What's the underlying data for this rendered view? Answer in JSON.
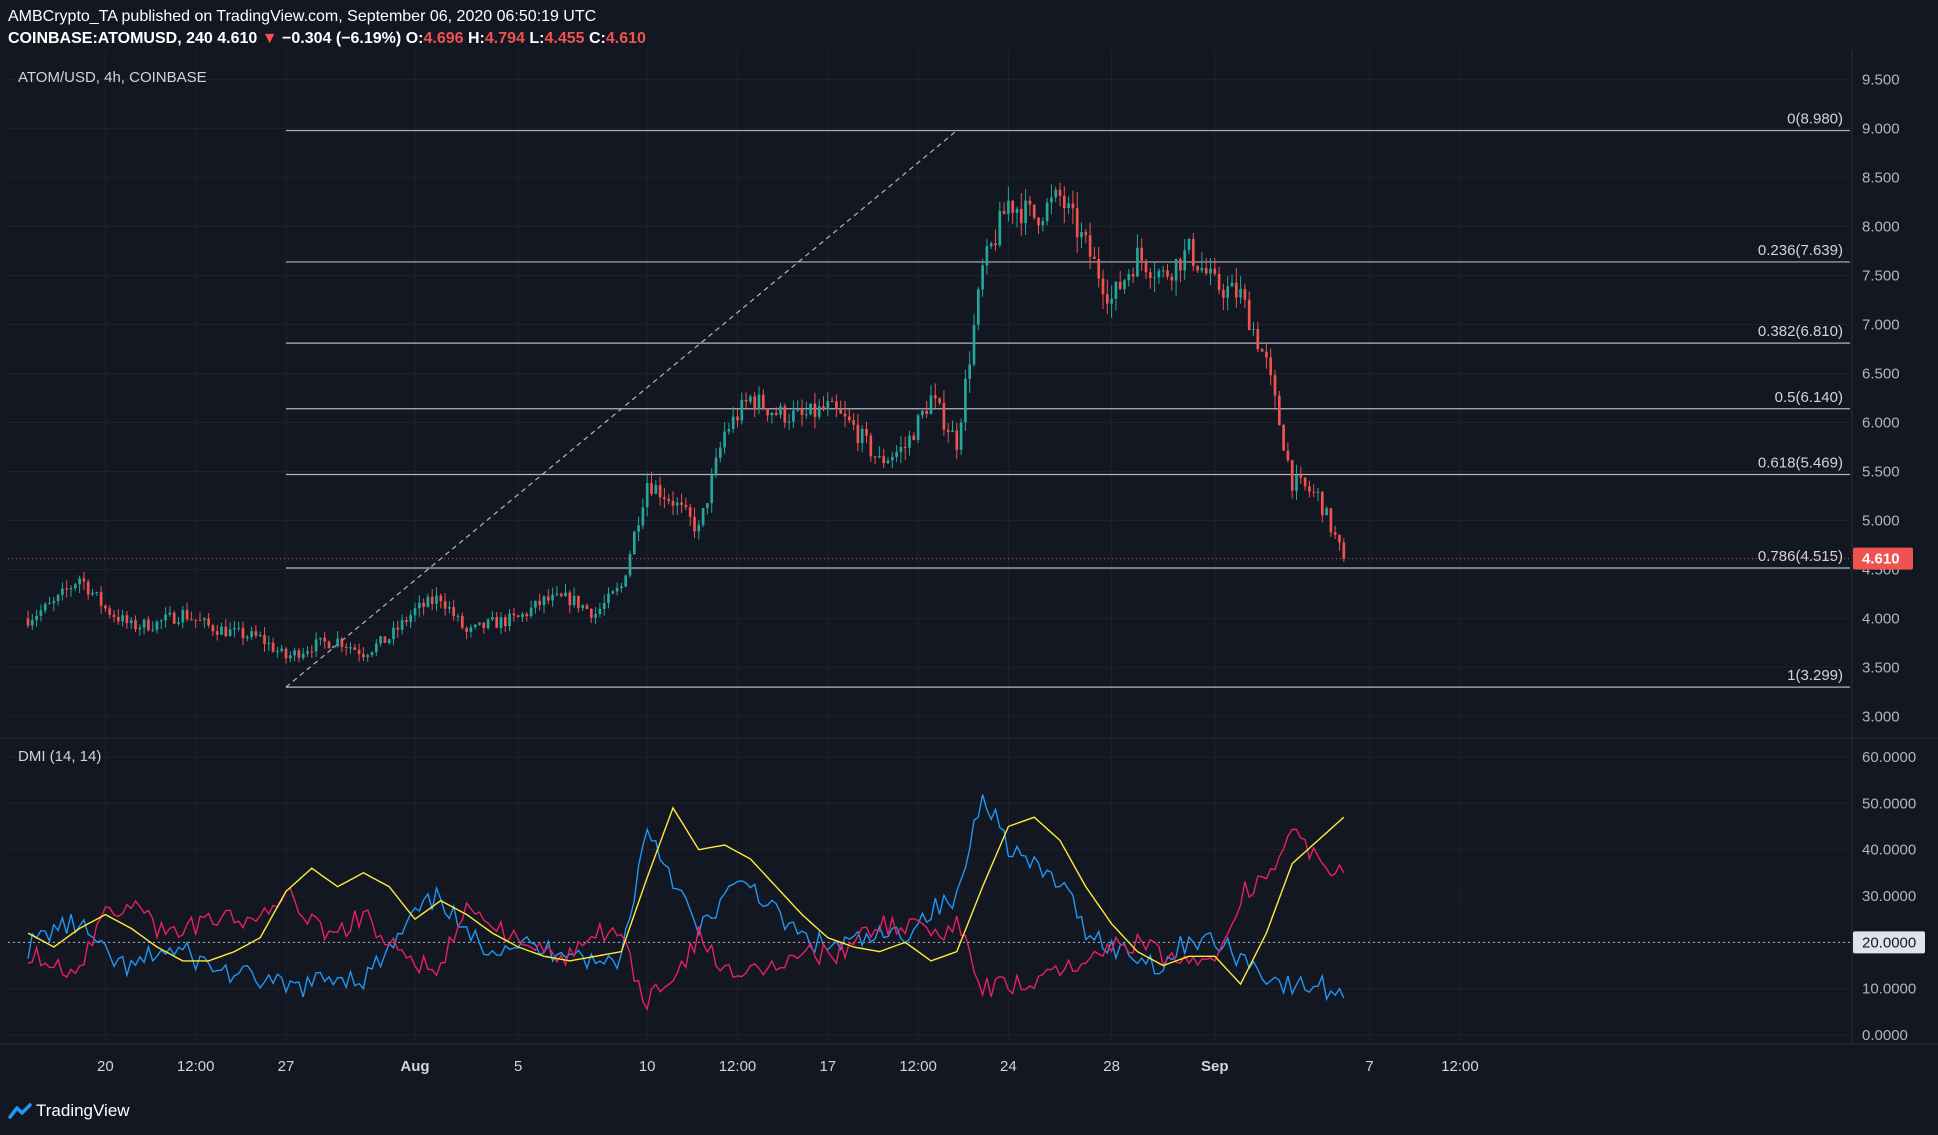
{
  "header": {
    "publisher_line": "AMBCrypto_TA published on TradingView.com, September 06, 2020 06:50:19 UTC",
    "symbol": "COINBASE:ATOMUSD, 240",
    "last": "4.610",
    "change": "−0.304 (−6.19%)",
    "o_label": "O:",
    "o": "4.696",
    "h_label": "H:",
    "h": "4.794",
    "l_label": "L:",
    "l": "4.455",
    "c_label": "C:",
    "c": "4.610"
  },
  "footer": {
    "brand": "TradingView"
  },
  "colors": {
    "bg": "#131722",
    "up": "#26a69a",
    "down": "#ef5350",
    "di_plus": "#2196f3",
    "di_minus": "#e91e63",
    "adx": "#ffeb3b"
  },
  "chart_data": [
    {
      "type": "candlestick",
      "title": "ATOM/USD, 4h, COINBASE",
      "y_ticks": [
        "9.500",
        "9.000",
        "8.500",
        "8.000",
        "7.500",
        "7.000",
        "6.500",
        "6.000",
        "5.500",
        "5.000",
        "4.500",
        "4.000",
        "3.500",
        "3.000"
      ],
      "ylim": [
        2.8,
        9.7
      ],
      "x_ticks": [
        "20",
        "12:00",
        "27",
        "Aug",
        "5",
        "10",
        "12:00",
        "17",
        "12:00",
        "24",
        "28",
        "Sep",
        "7",
        "12:00"
      ],
      "last_price": "4.610",
      "grid": true,
      "fib_levels": [
        {
          "label": "0(8.980)",
          "value": 8.98
        },
        {
          "label": "0.236(7.639)",
          "value": 7.639
        },
        {
          "label": "0.382(6.810)",
          "value": 6.81
        },
        {
          "label": "0.5(6.140)",
          "value": 6.14
        },
        {
          "label": "0.618(5.469)",
          "value": 5.469
        },
        {
          "label": "0.786(4.515)",
          "value": 4.515
        },
        {
          "label": "1(3.299)",
          "value": 3.299
        }
      ],
      "fib_trendline": {
        "from": {
          "date": "2020-07-27",
          "price": 3.299
        },
        "to": {
          "date": "2020-08-22",
          "price": 8.98
        }
      },
      "close_anchors": [
        [
          "2020-07-17",
          4.0
        ],
        [
          "2020-07-18",
          4.15
        ],
        [
          "2020-07-19",
          4.42
        ],
        [
          "2020-07-20",
          4.1
        ],
        [
          "2020-07-21",
          3.92
        ],
        [
          "2020-07-22",
          3.95
        ],
        [
          "2020-07-23",
          4.05
        ],
        [
          "2020-07-24",
          3.92
        ],
        [
          "2020-07-25",
          3.85
        ],
        [
          "2020-07-26",
          3.8
        ],
        [
          "2020-07-27",
          3.6
        ],
        [
          "2020-07-28",
          3.72
        ],
        [
          "2020-07-29",
          3.78
        ],
        [
          "2020-07-30",
          3.65
        ],
        [
          "2020-07-31",
          3.8
        ],
        [
          "2020-08-01",
          4.08
        ],
        [
          "2020-08-02",
          4.22
        ],
        [
          "2020-08-03",
          3.85
        ],
        [
          "2020-08-04",
          3.95
        ],
        [
          "2020-08-05",
          4.0
        ],
        [
          "2020-08-06",
          4.18
        ],
        [
          "2020-08-07",
          4.2
        ],
        [
          "2020-08-08",
          4.05
        ],
        [
          "2020-08-09",
          4.32
        ],
        [
          "2020-08-10",
          5.4
        ],
        [
          "2020-08-11",
          5.2
        ],
        [
          "2020-08-12",
          4.9
        ],
        [
          "2020-08-13",
          5.9
        ],
        [
          "2020-08-14",
          6.25
        ],
        [
          "2020-08-15",
          6.1
        ],
        [
          "2020-08-16",
          6.05
        ],
        [
          "2020-08-17",
          6.15
        ],
        [
          "2020-08-18",
          5.95
        ],
        [
          "2020-08-19",
          5.6
        ],
        [
          "2020-08-20",
          5.75
        ],
        [
          "2020-08-21",
          6.25
        ],
        [
          "2020-08-22",
          5.8
        ],
        [
          "2020-08-23",
          7.55
        ],
        [
          "2020-08-24",
          8.25
        ],
        [
          "2020-08-25",
          8.1
        ],
        [
          "2020-08-26",
          8.3
        ],
        [
          "2020-08-27",
          7.8
        ],
        [
          "2020-08-28",
          7.25
        ],
        [
          "2020-08-29",
          7.7
        ],
        [
          "2020-08-30",
          7.5
        ],
        [
          "2020-08-31",
          7.75
        ],
        [
          "2020-09-01",
          7.4
        ],
        [
          "2020-09-02",
          7.3
        ],
        [
          "2020-09-03",
          6.6
        ],
        [
          "2020-09-04",
          5.4
        ],
        [
          "2020-09-05",
          5.25
        ],
        [
          "2020-09-06",
          4.61
        ]
      ]
    },
    {
      "type": "line",
      "title": "DMI (14, 14)",
      "y_ticks": [
        "60.0000",
        "50.0000",
        "40.0000",
        "30.0000",
        "20.0000",
        "10.0000",
        "0.0000"
      ],
      "ylim": [
        -1.5,
        61.5
      ],
      "threshold": 20,
      "threshold_label": "20.0000",
      "series": [
        {
          "key": "di_plus",
          "color": "#2196f3",
          "values": [
            [
              "2020-07-17",
              19
            ],
            [
              "2020-07-18",
              23
            ],
            [
              "2020-07-19",
              24
            ],
            [
              "2020-07-20",
              17
            ],
            [
              "2020-07-21",
              14
            ],
            [
              "2020-07-22",
              18
            ],
            [
              "2020-07-23",
              18
            ],
            [
              "2020-07-24",
              15
            ],
            [
              "2020-07-25",
              13
            ],
            [
              "2020-07-26",
              12
            ],
            [
              "2020-07-27",
              10
            ],
            [
              "2020-07-28",
              11
            ],
            [
              "2020-07-29",
              13
            ],
            [
              "2020-07-30",
              12
            ],
            [
              "2020-07-31",
              18
            ],
            [
              "2020-08-01",
              26
            ],
            [
              "2020-08-02",
              30
            ],
            [
              "2020-08-03",
              21
            ],
            [
              "2020-08-04",
              19
            ],
            [
              "2020-08-05",
              20
            ],
            [
              "2020-08-06",
              18
            ],
            [
              "2020-08-07",
              19
            ],
            [
              "2020-08-08",
              15
            ],
            [
              "2020-08-09",
              17
            ],
            [
              "2020-08-10",
              45
            ],
            [
              "2020-08-11",
              34
            ],
            [
              "2020-08-12",
              22
            ],
            [
              "2020-08-13",
              30
            ],
            [
              "2020-08-14",
              33
            ],
            [
              "2020-08-15",
              26
            ],
            [
              "2020-08-16",
              21
            ],
            [
              "2020-08-17",
              19
            ],
            [
              "2020-08-18",
              20
            ],
            [
              "2020-08-19",
              21
            ],
            [
              "2020-08-20",
              22
            ],
            [
              "2020-08-21",
              27
            ],
            [
              "2020-08-22",
              29
            ],
            [
              "2020-08-23",
              53
            ],
            [
              "2020-08-24",
              41
            ],
            [
              "2020-08-25",
              36
            ],
            [
              "2020-08-26",
              33
            ],
            [
              "2020-08-27",
              23
            ],
            [
              "2020-08-28",
              19
            ],
            [
              "2020-08-29",
              17
            ],
            [
              "2020-08-30",
              15
            ],
            [
              "2020-08-31",
              21
            ],
            [
              "2020-09-01",
              20
            ],
            [
              "2020-09-02",
              17
            ],
            [
              "2020-09-03",
              13
            ],
            [
              "2020-09-04",
              10
            ],
            [
              "2020-09-05",
              11
            ],
            [
              "2020-09-06",
              8
            ]
          ]
        },
        {
          "key": "di_minus",
          "color": "#e91e63",
          "values": [
            [
              "2020-07-17",
              18
            ],
            [
              "2020-07-18",
              14
            ],
            [
              "2020-07-19",
              13
            ],
            [
              "2020-07-20",
              28
            ],
            [
              "2020-07-21",
              28
            ],
            [
              "2020-07-22",
              23
            ],
            [
              "2020-07-23",
              22
            ],
            [
              "2020-07-24",
              25
            ],
            [
              "2020-07-25",
              26
            ],
            [
              "2020-07-26",
              24
            ],
            [
              "2020-07-27",
              32
            ],
            [
              "2020-07-28",
              24
            ],
            [
              "2020-07-29",
              22
            ],
            [
              "2020-07-30",
              26
            ],
            [
              "2020-07-31",
              21
            ],
            [
              "2020-08-01",
              16
            ],
            [
              "2020-08-02",
              14
            ],
            [
              "2020-08-03",
              28
            ],
            [
              "2020-08-04",
              24
            ],
            [
              "2020-08-05",
              21
            ],
            [
              "2020-08-06",
              18
            ],
            [
              "2020-08-07",
              17
            ],
            [
              "2020-08-08",
              22
            ],
            [
              "2020-08-09",
              21
            ],
            [
              "2020-08-10",
              7
            ],
            [
              "2020-08-11",
              12
            ],
            [
              "2020-08-12",
              21
            ],
            [
              "2020-08-13",
              15
            ],
            [
              "2020-08-14",
              13
            ],
            [
              "2020-08-15",
              15
            ],
            [
              "2020-08-16",
              18
            ],
            [
              "2020-08-17",
              17
            ],
            [
              "2020-08-18",
              20
            ],
            [
              "2020-08-19",
              24
            ],
            [
              "2020-08-20",
              23
            ],
            [
              "2020-08-21",
              22
            ],
            [
              "2020-08-22",
              24
            ],
            [
              "2020-08-23",
              11
            ],
            [
              "2020-08-24",
              10
            ],
            [
              "2020-08-25",
              12
            ],
            [
              "2020-08-26",
              13
            ],
            [
              "2020-08-27",
              16
            ],
            [
              "2020-08-28",
              19
            ],
            [
              "2020-08-29",
              20
            ],
            [
              "2020-08-30",
              17
            ],
            [
              "2020-08-31",
              16
            ],
            [
              "2020-09-01",
              18
            ],
            [
              "2020-09-02",
              30
            ],
            [
              "2020-09-03",
              34
            ],
            [
              "2020-09-04",
              44
            ],
            [
              "2020-09-05",
              37
            ],
            [
              "2020-09-06",
              35
            ]
          ]
        },
        {
          "key": "adx",
          "color": "#ffeb3b",
          "values": [
            [
              "2020-07-17",
              22
            ],
            [
              "2020-07-18",
              19
            ],
            [
              "2020-07-19",
              23
            ],
            [
              "2020-07-20",
              26
            ],
            [
              "2020-07-21",
              23
            ],
            [
              "2020-07-22",
              19
            ],
            [
              "2020-07-23",
              16
            ],
            [
              "2020-07-24",
              16
            ],
            [
              "2020-07-25",
              18
            ],
            [
              "2020-07-26",
              21
            ],
            [
              "2020-07-27",
              31
            ],
            [
              "2020-07-28",
              36
            ],
            [
              "2020-07-29",
              32
            ],
            [
              "2020-07-30",
              35
            ],
            [
              "2020-07-31",
              32
            ],
            [
              "2020-08-01",
              25
            ],
            [
              "2020-08-02",
              29
            ],
            [
              "2020-08-03",
              26
            ],
            [
              "2020-08-04",
              22
            ],
            [
              "2020-08-05",
              19
            ],
            [
              "2020-08-06",
              17
            ],
            [
              "2020-08-07",
              16
            ],
            [
              "2020-08-08",
              17
            ],
            [
              "2020-08-09",
              18
            ],
            [
              "2020-08-10",
              34
            ],
            [
              "2020-08-11",
              49
            ],
            [
              "2020-08-12",
              40
            ],
            [
              "2020-08-13",
              41
            ],
            [
              "2020-08-14",
              38
            ],
            [
              "2020-08-15",
              32
            ],
            [
              "2020-08-16",
              26
            ],
            [
              "2020-08-17",
              21
            ],
            [
              "2020-08-18",
              19
            ],
            [
              "2020-08-19",
              18
            ],
            [
              "2020-08-20",
              20
            ],
            [
              "2020-08-21",
              16
            ],
            [
              "2020-08-22",
              18
            ],
            [
              "2020-08-23",
              32
            ],
            [
              "2020-08-24",
              45
            ],
            [
              "2020-08-25",
              47
            ],
            [
              "2020-08-26",
              42
            ],
            [
              "2020-08-27",
              32
            ],
            [
              "2020-08-28",
              24
            ],
            [
              "2020-08-29",
              18
            ],
            [
              "2020-08-30",
              15
            ],
            [
              "2020-08-31",
              17
            ],
            [
              "2020-09-01",
              17
            ],
            [
              "2020-09-02",
              11
            ],
            [
              "2020-09-03",
              22
            ],
            [
              "2020-09-04",
              37
            ],
            [
              "2020-09-05",
              42
            ],
            [
              "2020-09-06",
              47
            ]
          ]
        }
      ]
    }
  ]
}
